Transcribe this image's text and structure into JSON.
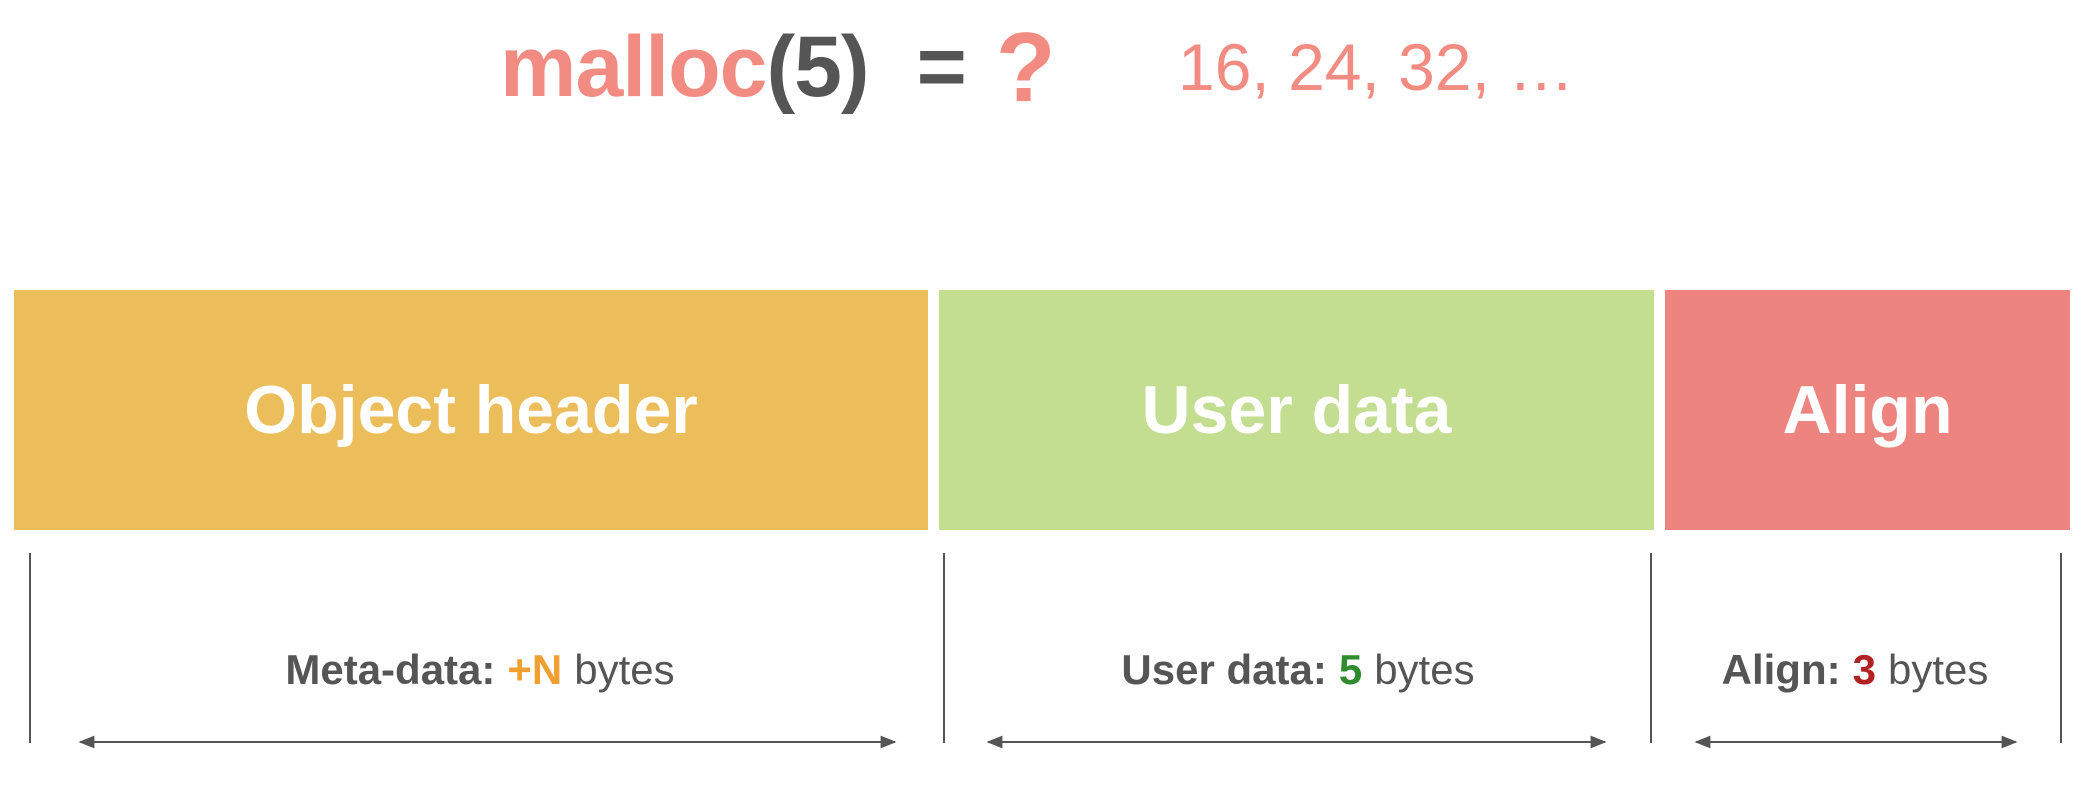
{
  "title": {
    "function": "malloc",
    "argument": "(5)",
    "equals": "=",
    "question": "?",
    "sizes": "16, 24, 32, …"
  },
  "blocks": {
    "header": "Object header",
    "user": "User data",
    "align": "Align"
  },
  "captions": {
    "meta": {
      "label": "Meta-data:",
      "value": "+N",
      "unit": "bytes"
    },
    "user": {
      "label": "User data:",
      "value": "5",
      "unit": "bytes"
    },
    "align": {
      "label": "Align:",
      "value": "3",
      "unit": "bytes"
    }
  },
  "colors": {
    "function": "#f28b82",
    "argument": "#555555",
    "header": "#ecbd5b",
    "user": "#c3dd91",
    "align": "#ee847f",
    "meta_value": "#f0a030",
    "user_value": "#2e8b2e",
    "align_value": "#b22222",
    "line": "#555555"
  }
}
